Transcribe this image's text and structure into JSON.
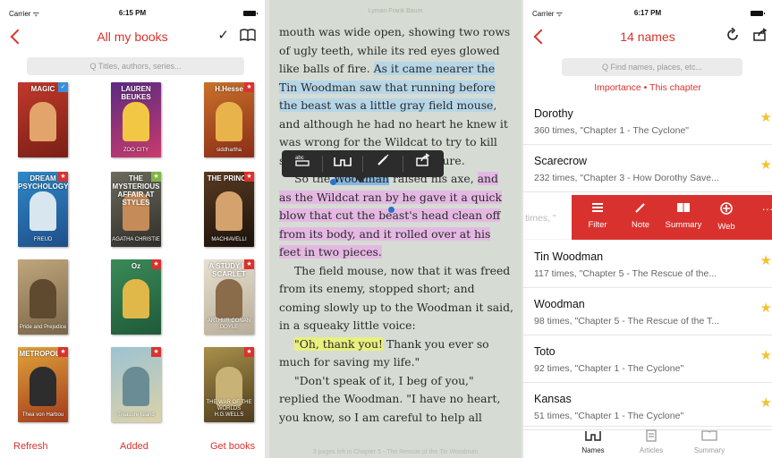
{
  "left_panel": {
    "status": {
      "carrier": "Carrier ᯤ",
      "time": "6:15 PM"
    },
    "title": "All my books",
    "search_placeholder": "Q Titles, authors, series...",
    "books": [
      {
        "title": "MAGIC",
        "subtitle": "",
        "colors": [
          "#c0392b",
          "#7a1f16"
        ],
        "figure": "#e2a46b",
        "tag": "check"
      },
      {
        "title": "LAUREN BEUKES",
        "subtitle": "ZOO CITY",
        "colors": [
          "#5b2b82",
          "#c83a6d"
        ],
        "figure": "#f2c744",
        "tag": ""
      },
      {
        "title": "H.Hesse",
        "subtitle": "siddhartha",
        "colors": [
          "#c9712a",
          "#8b2d18"
        ],
        "figure": "#e8b34a",
        "tag": "new"
      },
      {
        "title": "DREAM PSYCHOLOGY",
        "subtitle": "FREUD",
        "colors": [
          "#2f89c8",
          "#1e4f8a"
        ],
        "figure": "#d8e6f0",
        "tag": "new"
      },
      {
        "title": "THE MYSTERIOUS AFFAIR AT STYLES",
        "subtitle": "AGATHA CHRISTIE",
        "colors": [
          "#6d6b5d",
          "#2f2e29"
        ],
        "figure": "#c58b58",
        "tag": "new-green"
      },
      {
        "title": "THE PRINCE",
        "subtitle": "MACHIAVELLI",
        "colors": [
          "#5a3b22",
          "#1a120b"
        ],
        "figure": "#d4a26d",
        "tag": "new"
      },
      {
        "title": "",
        "subtitle": "Pride and Prejudice",
        "colors": [
          "#bfa67c",
          "#7a6549"
        ],
        "figure": "#5f4a30",
        "tag": ""
      },
      {
        "title": "Oz",
        "subtitle": "",
        "colors": [
          "#3b8a58",
          "#1f5a39"
        ],
        "figure": "#e0b84a",
        "tag": "new"
      },
      {
        "title": "A STUDY IN SCARLET",
        "subtitle": "ARTHUR CONAN DOYLE",
        "colors": [
          "#e7e0d1",
          "#b8ad97"
        ],
        "figure": "#8a6b4a",
        "tag": "new"
      },
      {
        "title": "METROPOLIS",
        "subtitle": "Thea von Harbou",
        "colors": [
          "#e0a43a",
          "#a33a1d"
        ],
        "figure": "#2d2d2d",
        "tag": "new"
      },
      {
        "title": "",
        "subtitle": "Treasure Island",
        "colors": [
          "#9cc3d2",
          "#dcd2a8"
        ],
        "figure": "#6a8c94",
        "tag": "new"
      },
      {
        "title": "",
        "subtitle": "THE WAR OF THE WORLDS H.G.WELLS",
        "colors": [
          "#a8904a",
          "#4e3b1d"
        ],
        "figure": "#c9b275",
        "tag": "new"
      }
    ],
    "toolbar": {
      "refresh": "Refresh",
      "added": "Added",
      "get_books": "Get books"
    }
  },
  "reader": {
    "header": "Lyman Frank Baum",
    "footer": "3 pages left in Chapter 5 - The Rescue of the Tin Woodman",
    "highlight_menu": [
      "abc-icon",
      "glasses-icon",
      "pen-icon",
      "share-icon"
    ],
    "p1": {
      "a": "mouth was wide open, showing two rows of ugly teeth, while its red eyes glowed like balls of fire. ",
      "b": "As it came nearer the Tin Woodman saw that running before the beast was a little gray field mouse",
      "c": ", and although he had no heart he knew it was wrong for the Wildcat to try to kill such a pretty, harmless creature."
    },
    "p2": {
      "a": "So the ",
      "sel": "Woodman",
      "b": " raised his axe, ",
      "c": "and as the Wildcat ran by he gave it a quick blow that cut the beast's head clean off from its body, and it rolled over at his feet in two pieces."
    },
    "p3": "The field mouse, now that it was freed from its enemy, stopped short; and coming slowly up to the Woodman it said, in a squeaky little voice:",
    "p4": {
      "a": "\"Oh, thank you!",
      "b": " Thank you ever so much for saving my life.\""
    },
    "p5": "\"Don't speak of it, I beg of you,\" replied the Woodman. \"I have no heart, you know, so I am careful to help all"
  },
  "right_panel": {
    "status": {
      "carrier": "Carrier ᯤ",
      "time": "6:17 PM"
    },
    "title": "14 names",
    "search_placeholder": "Q Find names, places, etc...",
    "filter": "Importance • This chapter",
    "names": [
      {
        "name": "Dorothy",
        "detail": "360 times, \"Chapter 1 - The Cyclone\""
      },
      {
        "name": "Scarecrow",
        "detail": "232 times, \"Chapter 3 - How Dorothy Save..."
      },
      {
        "name": "",
        "detail": "times, \""
      },
      {
        "name": "Tin Woodman",
        "detail": "117 times, \"Chapter 5 - The Rescue of the..."
      },
      {
        "name": "Woodman",
        "detail": "98 times, \"Chapter 5 - The Rescue of the T..."
      },
      {
        "name": "Toto",
        "detail": "92 times, \"Chapter 1 - The Cyclone\""
      },
      {
        "name": "Kansas",
        "detail": "51 times, \"Chapter 1 - The Cyclone\""
      }
    ],
    "actions": {
      "filter": "Filter",
      "note": "Note",
      "summary": "Summary",
      "web": "Web"
    },
    "tabs": {
      "names": "Names",
      "articles": "Articles",
      "summary": "Summary"
    },
    "accent": "#d9322e",
    "star_color": "#f1c232"
  }
}
